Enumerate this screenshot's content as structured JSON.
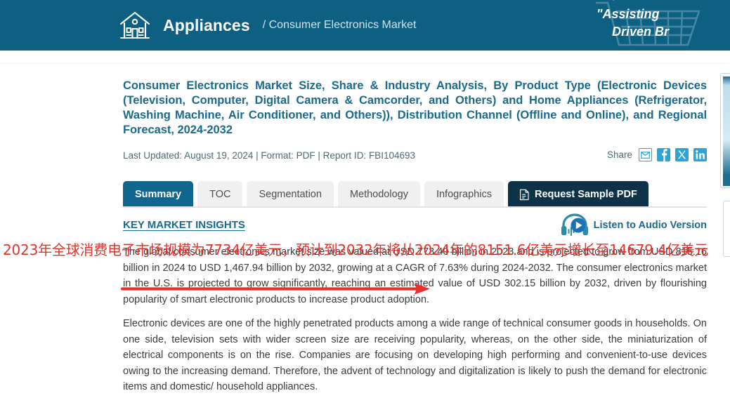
{
  "header": {
    "brand": "Appliances",
    "breadcrumb": "/ Consumer Electronics Market",
    "house_icon": "house-icon",
    "cart_icon": "shopping-cart-watermark-icon",
    "quote_line1": "\"Assisting",
    "quote_line2": "Driven Br"
  },
  "report": {
    "title": "Consumer Electronics Market Size, Share & Industry Analysis, By Product Type (Electronic Devices (Television, Computer, Digital Camera & Camcorder, and Others) and Home Appliances (Refrigerator, Washing Machine, Air Conditioner, and Others)), Distribution Channel (Offline and Online), and Regional Forecast, 2024-2032",
    "meta": "Last Updated: August 19, 2024 | Format: PDF | Report ID: FBI104693",
    "last_updated": "August 19, 2024",
    "format": "PDF",
    "report_id": "FBI104693"
  },
  "share": {
    "label": "Share",
    "items": [
      {
        "name": "email-icon",
        "glyph": "✉"
      },
      {
        "name": "facebook-icon",
        "glyph": "f"
      },
      {
        "name": "x-twitter-icon",
        "glyph": "✕"
      },
      {
        "name": "linkedin-icon",
        "glyph": "in"
      }
    ]
  },
  "tabs": [
    {
      "label": "Summary",
      "active": true
    },
    {
      "label": "TOC",
      "active": false
    },
    {
      "label": "Segmentation",
      "active": false
    },
    {
      "label": "Methodology",
      "active": false
    },
    {
      "label": "Infographics",
      "active": false
    }
  ],
  "cta": {
    "label": "Request Sample PDF",
    "icon": "document-pdf-icon"
  },
  "insights": {
    "heading": "KEY MARKET INSIGHTS",
    "audio_label": "Listen to Audio Version",
    "audio_icon": "headphones-play-icon"
  },
  "body": {
    "paragraph_1": "The global consumer electronics market size was valued at USD 773.40 billion in 2023 and is projected to grow from USD 815.16 billion in 2024 to USD 1,467.94 billion by 2032, growing at a CAGR of 7.63% during 2024-2032. The consumer electronics market in the U.S. is projected to grow significantly, reaching an estimated value of USD 302.15 billion by 2032, driven by flourishing popularity of smart electronic products to increase product adoption.",
    "paragraph_2": "Electronic devices are one of the highly penetrated products among a wide range of technical consumer goods in households. On one side, television sets with wider screen size are receiving popularity, whereas, on the other side, the miniaturization of electrical components is on the rise. Companies are focusing on developing high performing and convenient-to-use devices owing to the increasing demand. Therefore, the advent of technology and digitalization is likely to push the demand for electronic items and domestic/ household appliances."
  },
  "annotation": {
    "chinese_text": "2023年全球消费电子市场规模为7734亿美元，预计到2032年将从2024年的8151.6亿美元增长至14679.4亿美元",
    "arrow_color": "#e8312a"
  },
  "colors": {
    "header_bg": "#0d6082",
    "brand_blue": "#1a6a8c",
    "active_tab": "#10668c",
    "cta_bg": "#0e3349",
    "share_blue": "#2ba4d8",
    "annotation_red": "#e8312a",
    "body_text": "#3b3b3b"
  }
}
